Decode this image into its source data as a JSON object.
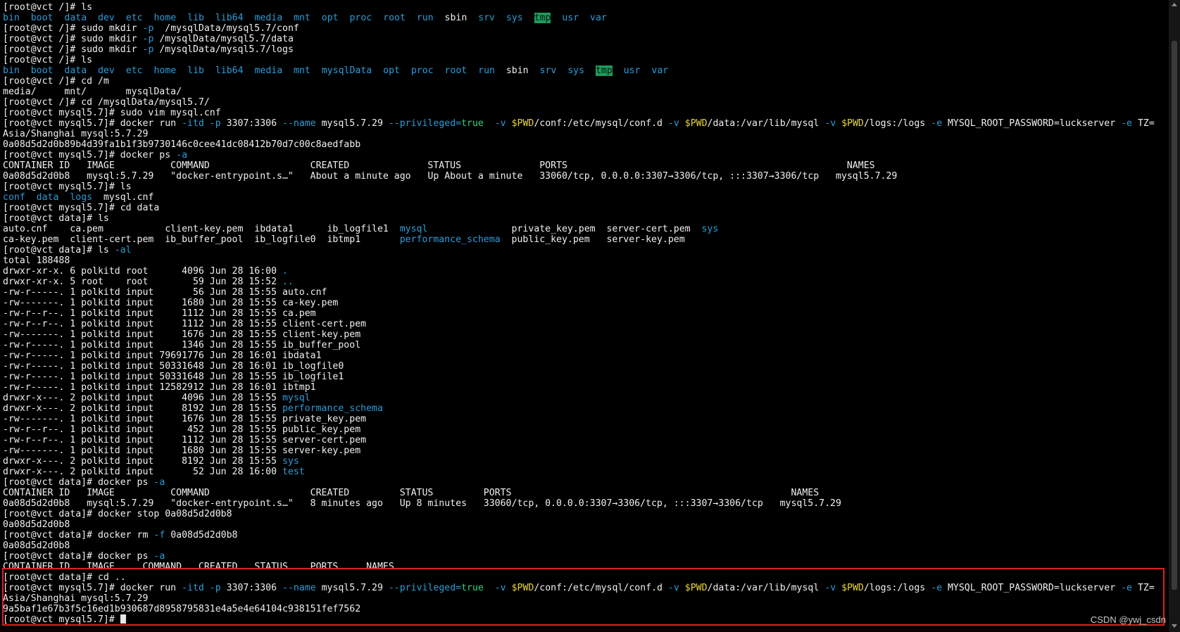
{
  "colors": {
    "background": "#000000",
    "text": "#f0f0f0",
    "directory": "#2d9bd6",
    "variable": "#e8d53b",
    "keyword": "#2fd27a",
    "highlight_box": "#e02020"
  },
  "lines": [
    [
      {
        "t": "[root@vct /]# ls"
      }
    ],
    [
      {
        "t": "bin",
        "c": "blue"
      },
      {
        "t": "  "
      },
      {
        "t": "boot",
        "c": "blue"
      },
      {
        "t": "  "
      },
      {
        "t": "data",
        "c": "blue"
      },
      {
        "t": "  "
      },
      {
        "t": "dev",
        "c": "blue"
      },
      {
        "t": "  "
      },
      {
        "t": "etc",
        "c": "blue"
      },
      {
        "t": "  "
      },
      {
        "t": "home",
        "c": "blue"
      },
      {
        "t": "  "
      },
      {
        "t": "lib",
        "c": "blue"
      },
      {
        "t": "  "
      },
      {
        "t": "lib64",
        "c": "blue"
      },
      {
        "t": "  "
      },
      {
        "t": "media",
        "c": "blue"
      },
      {
        "t": "  "
      },
      {
        "t": "mnt",
        "c": "blue"
      },
      {
        "t": "  "
      },
      {
        "t": "opt",
        "c": "blue"
      },
      {
        "t": "  "
      },
      {
        "t": "proc",
        "c": "blue"
      },
      {
        "t": "  "
      },
      {
        "t": "root",
        "c": "blue"
      },
      {
        "t": "  "
      },
      {
        "t": "run",
        "c": "blue"
      },
      {
        "t": "  "
      },
      {
        "t": "sbin"
      },
      {
        "t": "  "
      },
      {
        "t": "srv",
        "c": "blue"
      },
      {
        "t": "  "
      },
      {
        "t": "sys",
        "c": "blue"
      },
      {
        "t": "  "
      },
      {
        "t": "tmp",
        "c": "hl"
      },
      {
        "t": "  "
      },
      {
        "t": "usr",
        "c": "blue"
      },
      {
        "t": "  "
      },
      {
        "t": "var",
        "c": "blue"
      }
    ],
    [
      {
        "t": "[root@vct /]# sudo mkdir "
      },
      {
        "t": "-p",
        "c": "blue"
      },
      {
        "t": "  /mysqlData/mysql5.7/conf"
      }
    ],
    [
      {
        "t": "[root@vct /]# sudo mkdir "
      },
      {
        "t": "-p",
        "c": "blue"
      },
      {
        "t": " /mysqlData/mysql5.7/data"
      }
    ],
    [
      {
        "t": "[root@vct /]# sudo mkdir "
      },
      {
        "t": "-p",
        "c": "blue"
      },
      {
        "t": " /mysqlData/mysql5.7/logs"
      }
    ],
    [
      {
        "t": "[root@vct /]# ls"
      }
    ],
    [
      {
        "t": "bin",
        "c": "blue"
      },
      {
        "t": "  "
      },
      {
        "t": "boot",
        "c": "blue"
      },
      {
        "t": "  "
      },
      {
        "t": "data",
        "c": "blue"
      },
      {
        "t": "  "
      },
      {
        "t": "dev",
        "c": "blue"
      },
      {
        "t": "  "
      },
      {
        "t": "etc",
        "c": "blue"
      },
      {
        "t": "  "
      },
      {
        "t": "home",
        "c": "blue"
      },
      {
        "t": "  "
      },
      {
        "t": "lib",
        "c": "blue"
      },
      {
        "t": "  "
      },
      {
        "t": "lib64",
        "c": "blue"
      },
      {
        "t": "  "
      },
      {
        "t": "media",
        "c": "blue"
      },
      {
        "t": "  "
      },
      {
        "t": "mnt",
        "c": "blue"
      },
      {
        "t": "  "
      },
      {
        "t": "mysqlData",
        "c": "blue"
      },
      {
        "t": "  "
      },
      {
        "t": "opt",
        "c": "blue"
      },
      {
        "t": "  "
      },
      {
        "t": "proc",
        "c": "blue"
      },
      {
        "t": "  "
      },
      {
        "t": "root",
        "c": "blue"
      },
      {
        "t": "  "
      },
      {
        "t": "run",
        "c": "blue"
      },
      {
        "t": "  "
      },
      {
        "t": "sbin"
      },
      {
        "t": "  "
      },
      {
        "t": "srv",
        "c": "blue"
      },
      {
        "t": "  "
      },
      {
        "t": "sys",
        "c": "blue"
      },
      {
        "t": "  "
      },
      {
        "t": "tmp",
        "c": "hl"
      },
      {
        "t": "  "
      },
      {
        "t": "usr",
        "c": "blue"
      },
      {
        "t": "  "
      },
      {
        "t": "var",
        "c": "blue"
      }
    ],
    [
      {
        "t": "[root@vct /]# cd /m"
      }
    ],
    [
      {
        "t": "media/     mnt/       mysqlData/"
      }
    ],
    [
      {
        "t": "[root@vct /]# cd /mysqlData/mysql5.7/"
      }
    ],
    [
      {
        "t": "[root@vct mysql5.7]# sudo vim mysql.cnf"
      }
    ],
    [
      {
        "t": "[root@vct mysql5.7]# docker run "
      },
      {
        "t": "-itd -p",
        "c": "blue"
      },
      {
        "t": " 3307:3306 "
      },
      {
        "t": "--name",
        "c": "blue"
      },
      {
        "t": " mysql5.7.29 "
      },
      {
        "t": "--privileged=",
        "c": "blue"
      },
      {
        "t": "true",
        "c": "green"
      },
      {
        "t": "  "
      },
      {
        "t": "-v",
        "c": "blue"
      },
      {
        "t": " "
      },
      {
        "t": "$PWD",
        "c": "yellow"
      },
      {
        "t": "/conf:/etc/mysql/conf.d "
      },
      {
        "t": "-v",
        "c": "blue"
      },
      {
        "t": " "
      },
      {
        "t": "$PWD",
        "c": "yellow"
      },
      {
        "t": "/data:/var/lib/mysql "
      },
      {
        "t": "-v",
        "c": "blue"
      },
      {
        "t": " "
      },
      {
        "t": "$PWD",
        "c": "yellow"
      },
      {
        "t": "/logs:/logs "
      },
      {
        "t": "-e",
        "c": "blue"
      },
      {
        "t": " MYSQL_ROOT_PASSWORD=luckserver "
      },
      {
        "t": "-e",
        "c": "blue"
      },
      {
        "t": " TZ="
      }
    ],
    [
      {
        "t": "Asia/Shanghai mysql:5.7.29"
      }
    ],
    [
      {
        "t": "0a08d5d2d0b89b4d39fa1b1f3b9730146c0cee41dc08412b70d7c00c8aedfabb"
      }
    ],
    [
      {
        "t": "[root@vct mysql5.7]# docker ps "
      },
      {
        "t": "-a",
        "c": "blue"
      }
    ],
    [
      {
        "t": "CONTAINER ID   IMAGE          COMMAND                  CREATED              STATUS              PORTS                                                  NAMES"
      }
    ],
    [
      {
        "t": "0a08d5d2d0b8   mysql:5.7.29   \"docker-entrypoint.s…\"   About a minute ago   Up About a minute   33060/tcp, 0.0.0.0:3307→3306/tcp, :::3307→3306/tcp   mysql5.7.29"
      }
    ],
    [
      {
        "t": "[root@vct mysql5.7]# ls"
      }
    ],
    [
      {
        "t": "conf",
        "c": "blue"
      },
      {
        "t": "  "
      },
      {
        "t": "data",
        "c": "blue"
      },
      {
        "t": "  "
      },
      {
        "t": "logs",
        "c": "blue"
      },
      {
        "t": "  mysql.cnf"
      }
    ],
    [
      {
        "t": "[root@vct mysql5.7]# cd data"
      }
    ],
    [
      {
        "t": "[root@vct data]# ls"
      }
    ],
    [
      {
        "t": "auto.cnf    ca.pem           client-key.pem  ibdata1      ib_logfile1  "
      },
      {
        "t": "mysql",
        "c": "blue"
      },
      {
        "t": "               private_key.pem  server-cert.pem  "
      },
      {
        "t": "sys",
        "c": "blue"
      }
    ],
    [
      {
        "t": "ca-key.pem  client-cert.pem  ib_buffer_pool  ib_logfile0  ibtmp1       "
      },
      {
        "t": "performance_schema",
        "c": "blue"
      },
      {
        "t": "  public_key.pem   server-key.pem"
      }
    ],
    [
      {
        "t": "[root@vct data]# ls "
      },
      {
        "t": "-al",
        "c": "blue"
      }
    ],
    [
      {
        "t": "total 188488"
      }
    ],
    [
      {
        "t": "drwxr-xr-x. 6 polkitd root      4096 Jun 28 16:00 "
      },
      {
        "t": ".",
        "c": "blue"
      }
    ],
    [
      {
        "t": "drwxr-xr-x. 5 root    root        59 Jun 28 15:52 "
      },
      {
        "t": "..",
        "c": "blue"
      }
    ],
    [
      {
        "t": "-rw-r-----. 1 polkitd input       56 Jun 28 15:55 auto.cnf"
      }
    ],
    [
      {
        "t": "-rw-------. 1 polkitd input     1680 Jun 28 15:55 ca-key.pem"
      }
    ],
    [
      {
        "t": "-rw-r--r--. 1 polkitd input     1112 Jun 28 15:55 ca.pem"
      }
    ],
    [
      {
        "t": "-rw-r--r--. 1 polkitd input     1112 Jun 28 15:55 client-cert.pem"
      }
    ],
    [
      {
        "t": "-rw-------. 1 polkitd input     1676 Jun 28 15:55 client-key.pem"
      }
    ],
    [
      {
        "t": "-rw-r-----. 1 polkitd input     1346 Jun 28 15:55 ib_buffer_pool"
      }
    ],
    [
      {
        "t": "-rw-r-----. 1 polkitd input 79691776 Jun 28 16:01 ibdata1"
      }
    ],
    [
      {
        "t": "-rw-r-----. 1 polkitd input 50331648 Jun 28 16:01 ib_logfile0"
      }
    ],
    [
      {
        "t": "-rw-r-----. 1 polkitd input 50331648 Jun 28 15:55 ib_logfile1"
      }
    ],
    [
      {
        "t": "-rw-r-----. 1 polkitd input 12582912 Jun 28 16:01 ibtmp1"
      }
    ],
    [
      {
        "t": "drwxr-x---. 2 polkitd input     4096 Jun 28 15:55 "
      },
      {
        "t": "mysql",
        "c": "blue"
      }
    ],
    [
      {
        "t": "drwxr-x---. 2 polkitd input     8192 Jun 28 15:55 "
      },
      {
        "t": "performance_schema",
        "c": "blue"
      }
    ],
    [
      {
        "t": "-rw-------. 1 polkitd input     1676 Jun 28 15:55 private_key.pem"
      }
    ],
    [
      {
        "t": "-rw-r--r--. 1 polkitd input      452 Jun 28 15:55 public_key.pem"
      }
    ],
    [
      {
        "t": "-rw-r--r--. 1 polkitd input     1112 Jun 28 15:55 server-cert.pem"
      }
    ],
    [
      {
        "t": "-rw-------. 1 polkitd input     1680 Jun 28 15:55 server-key.pem"
      }
    ],
    [
      {
        "t": "drwxr-x---. 2 polkitd input     8192 Jun 28 15:55 "
      },
      {
        "t": "sys",
        "c": "blue"
      }
    ],
    [
      {
        "t": "drwxr-x---. 2 polkitd input       52 Jun 28 16:00 "
      },
      {
        "t": "test",
        "c": "blue"
      }
    ],
    [
      {
        "t": "[root@vct data]# docker ps "
      },
      {
        "t": "-a",
        "c": "blue"
      }
    ],
    [
      {
        "t": "CONTAINER ID   IMAGE          COMMAND                  CREATED         STATUS         PORTS                                                  NAMES"
      }
    ],
    [
      {
        "t": "0a08d5d2d0b8   mysql:5.7.29   \"docker-entrypoint.s…\"   8 minutes ago   Up 8 minutes   33060/tcp, 0.0.0.0:3307→3306/tcp, :::3307→3306/tcp   mysql5.7.29"
      }
    ],
    [
      {
        "t": "[root@vct data]# docker stop 0a08d5d2d0b8"
      }
    ],
    [
      {
        "t": "0a08d5d2d0b8"
      }
    ],
    [
      {
        "t": "[root@vct data]# docker rm "
      },
      {
        "t": "-f",
        "c": "blue"
      },
      {
        "t": " 0a08d5d2d0b8"
      }
    ],
    [
      {
        "t": "0a08d5d2d0b8"
      }
    ],
    [
      {
        "t": "[root@vct data]# docker ps "
      },
      {
        "t": "-a",
        "c": "blue"
      }
    ],
    [
      {
        "t": "CONTAINER ID   IMAGE     COMMAND   CREATED   STATUS    PORTS     NAMES"
      }
    ],
    [
      {
        "t": "[root@vct data]# cd .."
      }
    ],
    [
      {
        "t": "[root@vct mysql5.7]# docker run "
      },
      {
        "t": "-itd -p",
        "c": "blue"
      },
      {
        "t": " 3307:3306 "
      },
      {
        "t": "--name",
        "c": "blue"
      },
      {
        "t": " mysql5.7.29 "
      },
      {
        "t": "--privileged=",
        "c": "blue"
      },
      {
        "t": "true",
        "c": "green"
      },
      {
        "t": "  "
      },
      {
        "t": "-v",
        "c": "blue"
      },
      {
        "t": " "
      },
      {
        "t": "$PWD",
        "c": "yellow"
      },
      {
        "t": "/conf:/etc/mysql/conf.d "
      },
      {
        "t": "-v",
        "c": "blue"
      },
      {
        "t": " "
      },
      {
        "t": "$PWD",
        "c": "yellow"
      },
      {
        "t": "/data:/var/lib/mysql "
      },
      {
        "t": "-v",
        "c": "blue"
      },
      {
        "t": " "
      },
      {
        "t": "$PWD",
        "c": "yellow"
      },
      {
        "t": "/logs:/logs "
      },
      {
        "t": "-e",
        "c": "blue"
      },
      {
        "t": " MYSQL_ROOT_PASSWORD=luckserver "
      },
      {
        "t": "-e",
        "c": "blue"
      },
      {
        "t": " TZ="
      }
    ],
    [
      {
        "t": "Asia/Shanghai mysql:5.7.29"
      }
    ],
    [
      {
        "t": "9a5baf1e67b3f5c16ed1b930687d8958795831e4a5e4e64104c938151fef7562"
      }
    ],
    [
      {
        "t": "[root@vct mysql5.7]# "
      },
      {
        "t": "",
        "cursor": true
      }
    ]
  ],
  "watermark": "CSDN @ywj_csdn"
}
